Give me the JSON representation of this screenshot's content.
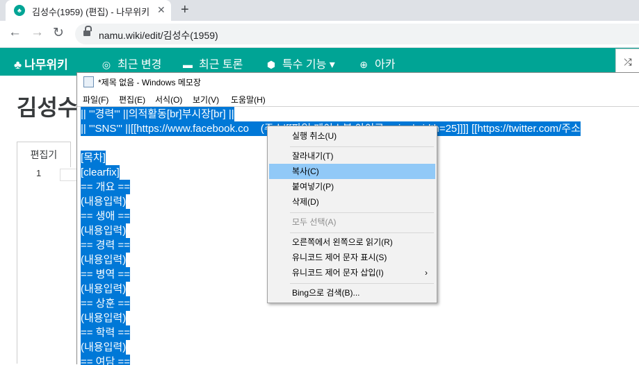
{
  "browser": {
    "tab_title": "김성수(1959) (편집) - 나무위키",
    "tab_close": "✕",
    "new_tab": "+",
    "back": "←",
    "forward": "→",
    "reload": "↻",
    "url": "namu.wiki/edit/김성수(1959)"
  },
  "namu": {
    "logo": "나무위키",
    "nav": [
      {
        "label": "최근 변경",
        "icon": "compass-icon"
      },
      {
        "label": "최근 토론",
        "icon": "comment-icon"
      },
      {
        "label": "특수 기능 ▾",
        "icon": "cube-icon"
      },
      {
        "label": "아카",
        "icon": "arca-icon"
      }
    ],
    "shuffle": "⤮"
  },
  "page": {
    "title": "김성수",
    "edit_tab": "편집기",
    "line_number": "1"
  },
  "notepad": {
    "title": "*제목 없음 - Windows 메모장",
    "menu": [
      "파일(F)",
      "편집(E)",
      "서식(O)",
      "보기(V)",
      "도움말(H)"
    ],
    "lines": [
      "|| '''경력''' ||의적활동[br]부시장[br] ||",
      "|| '''SNS''' ||[[https://www.facebook.co    (주소|[[파일:페이스북 아이콘.    jpg|width=25]]]] [[https://twitter.com/주소",
      "",
      "[목차]",
      "[clearfix]",
      "== 개요 ==",
      "(내용입력)",
      "== 생애 ==",
      "(내용입력)",
      "== 경력 ==",
      "(내용입력)",
      "== 병역 ==",
      "(내용입력)",
      "== 상훈 ==",
      "(내용입력)",
      "== 학력 ==",
      "(내용입력)",
      "== 여담 =="
    ]
  },
  "context_menu": {
    "items": [
      {
        "label": "실행 취소(U)",
        "state": "normal"
      },
      {
        "label": "잘라내기(T)",
        "state": "normal"
      },
      {
        "label": "복사(C)",
        "state": "highlighted"
      },
      {
        "label": "붙여넣기(P)",
        "state": "normal"
      },
      {
        "label": "삭제(D)",
        "state": "normal"
      },
      {
        "label": "모두 선택(A)",
        "state": "disabled"
      },
      {
        "label": "오른쪽에서 왼쪽으로 읽기(R)",
        "state": "normal"
      },
      {
        "label": "유니코드 제어 문자 표시(S)",
        "state": "normal"
      },
      {
        "label": "유니코드 제어 문자 삽입(I)",
        "state": "normal",
        "submenu": "›"
      },
      {
        "label": "Bing으로 검색(B)...",
        "state": "normal"
      }
    ]
  },
  "colors": {
    "namu_green": "#00a495",
    "selection": "#0078d7",
    "menu_highlight": "#91c9f7"
  }
}
